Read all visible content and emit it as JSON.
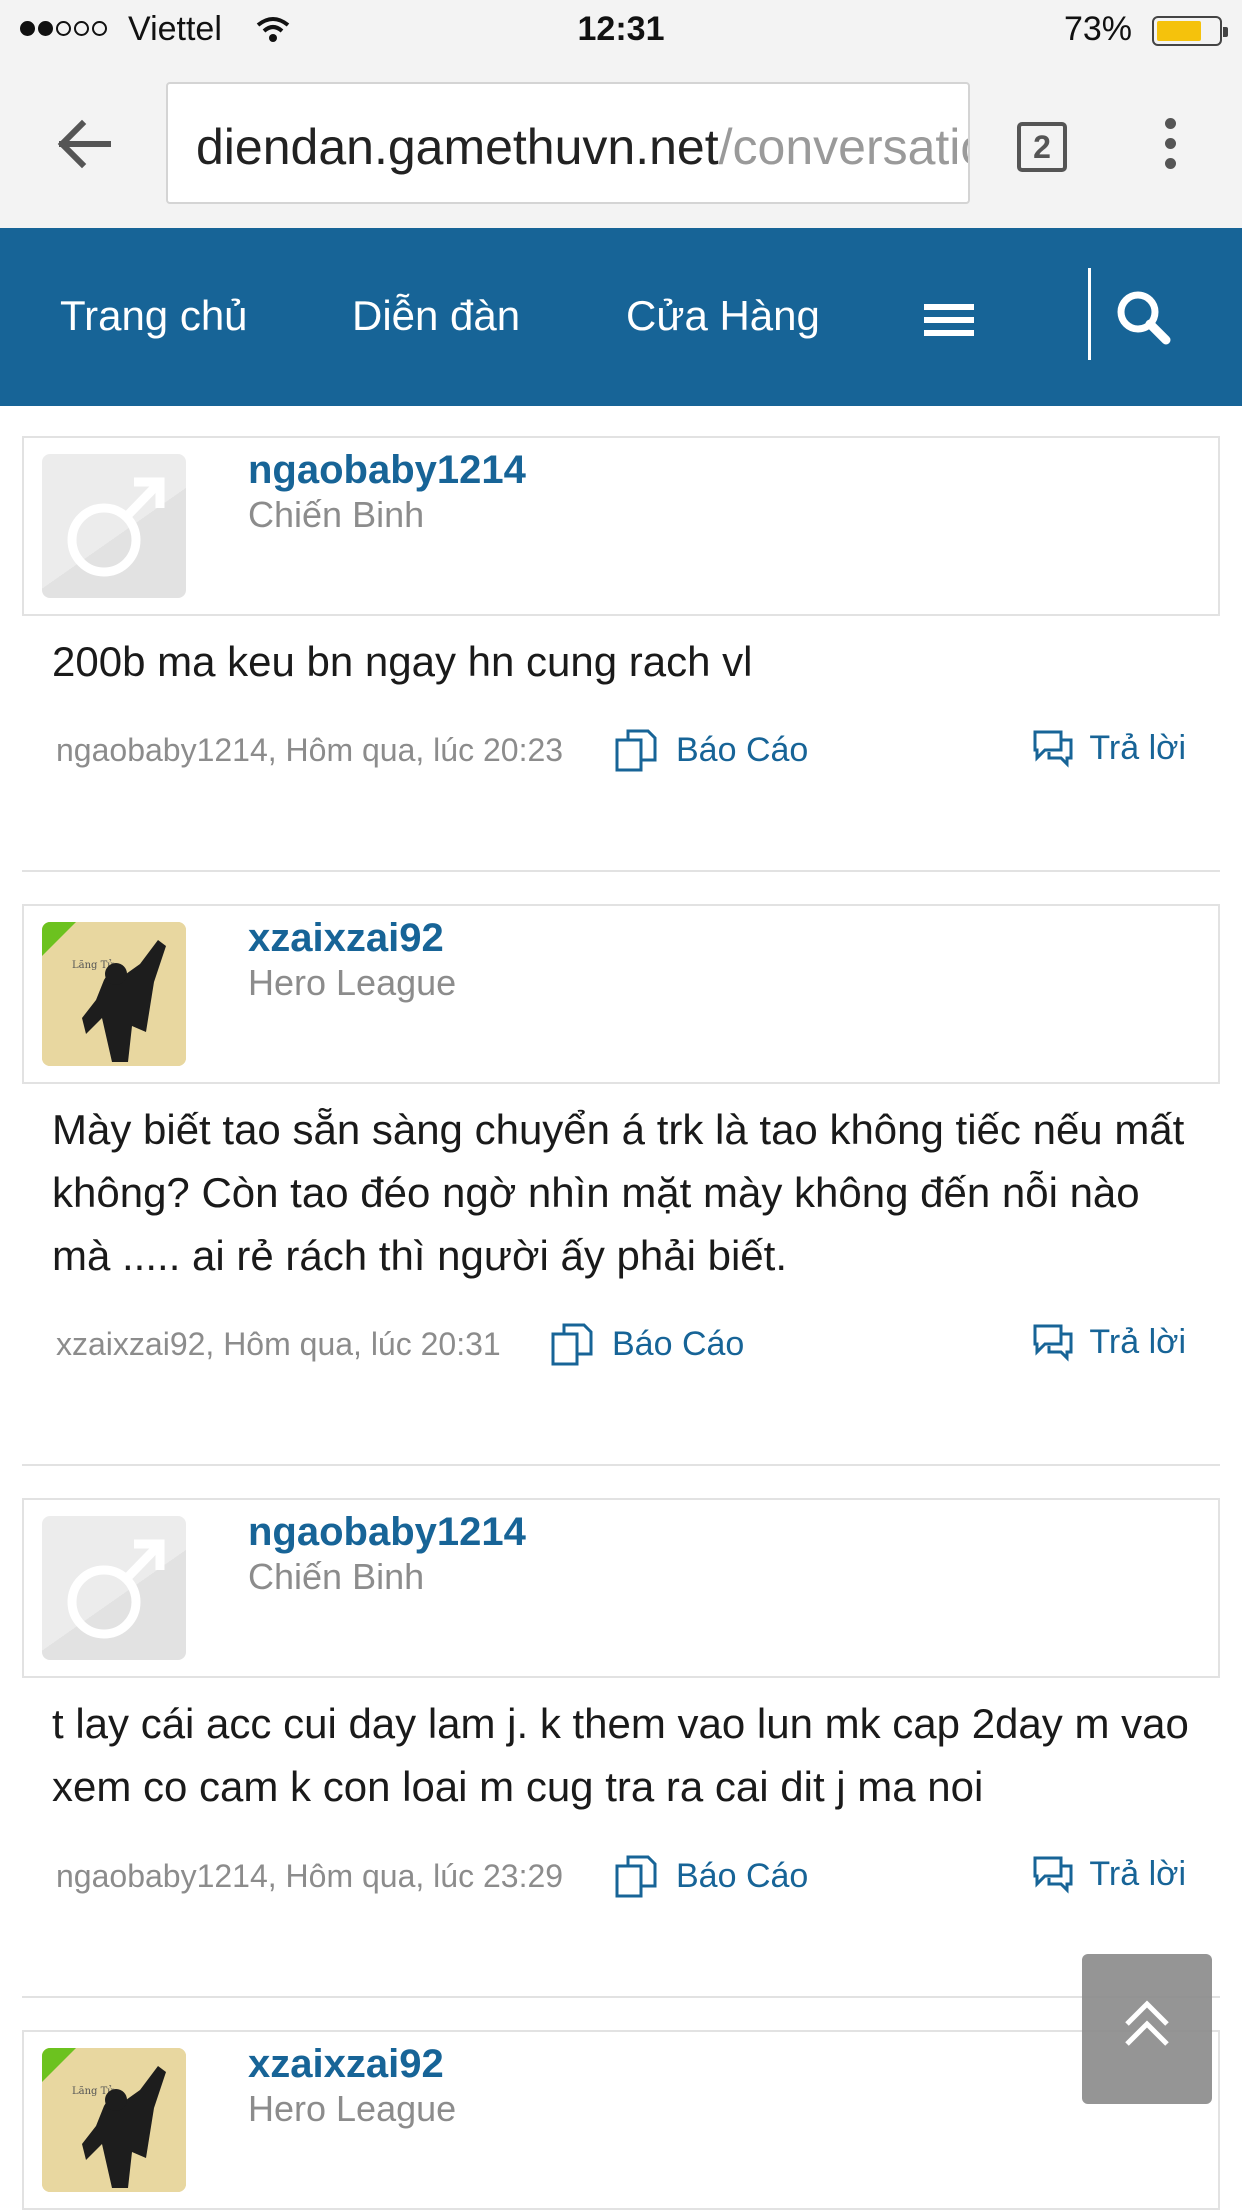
{
  "status_bar": {
    "carrier": "Viettel",
    "time": "12:31",
    "battery": "73%",
    "battery_level": 0.73,
    "signal_bars": 2,
    "signal_total": 5
  },
  "browser": {
    "url_host": "diendan.gamethuvn.net",
    "url_path": "/conversatio",
    "tab_count": "2"
  },
  "nav": {
    "home": "Trang chủ",
    "forum": "Diễn đàn",
    "shop": "Cửa Hàng"
  },
  "colors": {
    "brand": "#176497",
    "text_muted": "#8c8c8c"
  },
  "messages": [
    {
      "username": "ngaobaby1214",
      "user_title": "Chiến Binh",
      "avatar": "default-male-avatar",
      "body": "200b ma keu bn ngay hn cung rach vl",
      "meta": "ngaobaby1214, Hôm qua, lúc 20:23",
      "report": "Báo Cáo",
      "reply": "Trả lời"
    },
    {
      "username": "xzaixzai92",
      "user_title": "Hero League",
      "avatar": "photo-avatar",
      "avatar_caption": "Lãng Tử",
      "body": "Mày biết tao sẵn sàng chuyển á trk là tao không tiếc nếu mất không? Còn tao đéo ngờ nhìn mặt mày không đến nỗi nào mà ..... ai rẻ rách thì người ấy phải biết.",
      "meta": "xzaixzai92, Hôm qua, lúc 20:31",
      "report": "Báo Cáo",
      "reply": "Trả lời"
    },
    {
      "username": "ngaobaby1214",
      "user_title": "Chiến Binh",
      "avatar": "default-male-avatar",
      "body": "t lay cái acc cui day lam j. k them vao lun mk cap 2day m vao xem co cam k con loai m cug tra ra cai dit j ma noi",
      "meta": "ngaobaby1214, Hôm qua, lúc 23:29",
      "report": "Báo Cáo",
      "reply": "Trả lời"
    },
    {
      "username": "xzaixzai92",
      "user_title": "Hero League",
      "avatar": "photo-avatar",
      "avatar_caption": "Lãng Tử"
    }
  ]
}
